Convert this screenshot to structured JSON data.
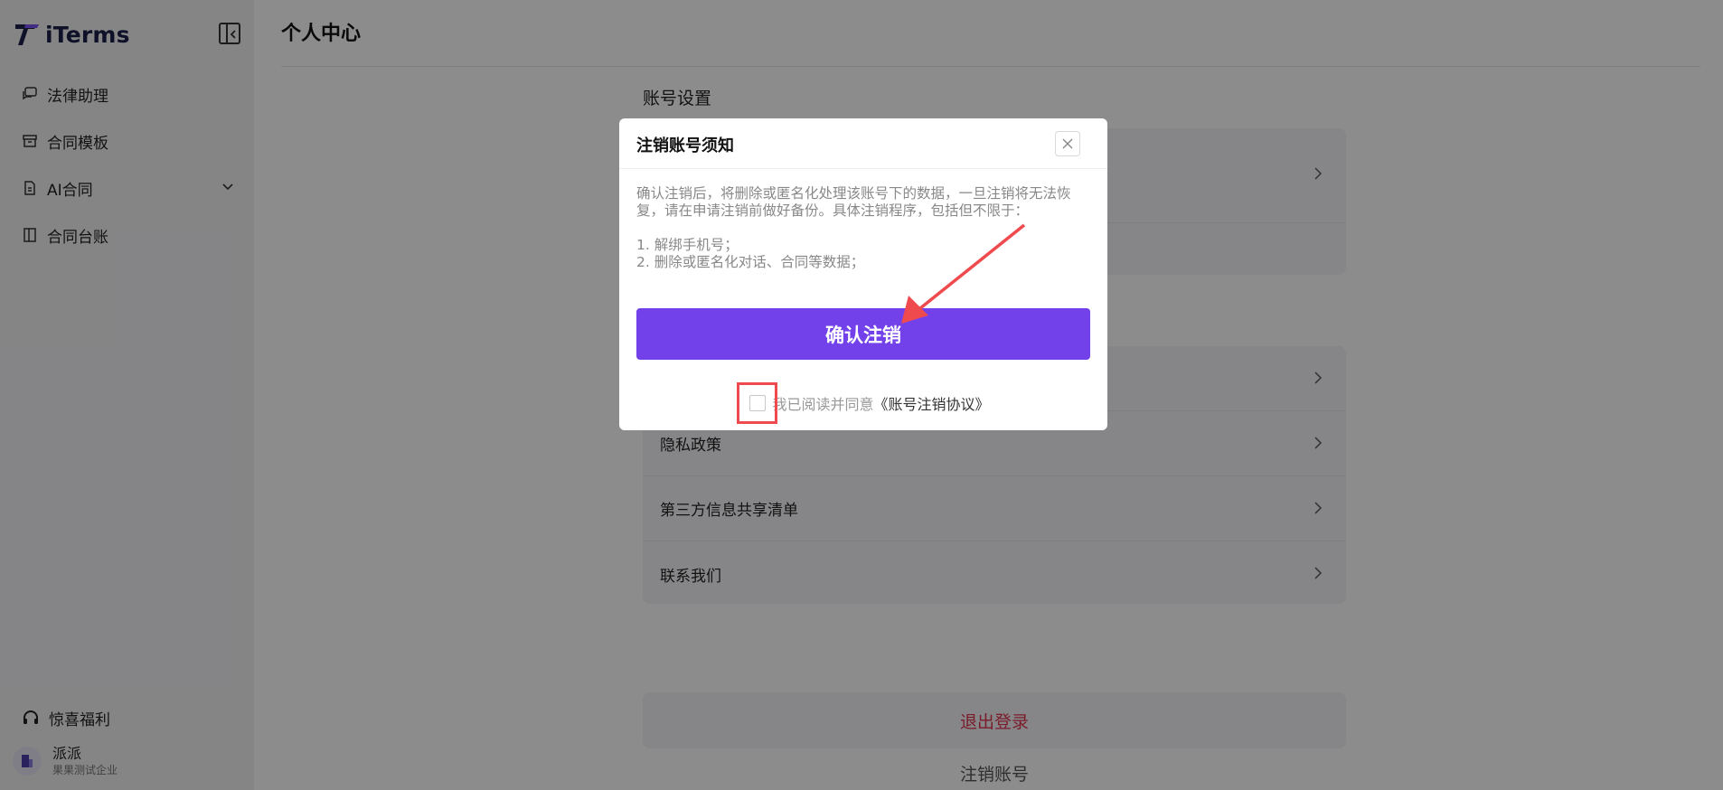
{
  "sidebar": {
    "brand": "iTerms",
    "nav": [
      {
        "label": "法律助理",
        "icon": "chat-icon"
      },
      {
        "label": "合同模板",
        "icon": "archive-icon"
      },
      {
        "label": "AI合同",
        "icon": "document-icon",
        "expandable": true
      },
      {
        "label": "合同台账",
        "icon": "ledger-icon"
      }
    ],
    "gift_label": "惊喜福利",
    "user": {
      "name": "派派",
      "org": "果果测试企业"
    }
  },
  "main": {
    "title": "个人中心",
    "section_title": "账号设置",
    "card2_rows": [
      "隐私政策",
      "第三方信息共享清单",
      "联系我们"
    ],
    "logout_label": "退出登录",
    "cancel_label": "注销账号"
  },
  "modal": {
    "title": "注销账号须知",
    "body": "确认注销后，将删除或匿名化处理该账号下的数据，一旦注销将无法恢复，请在申请注销前做好备份。具体注销程序，包括但不限于：",
    "list": [
      "1. 解绑手机号；",
      "2. 删除或匿名化对话、合同等数据；"
    ],
    "confirm_label": "确认注销",
    "agree_text": "我已阅读并同意",
    "agree_link": "《账号注销协议》"
  },
  "colors": {
    "accent": "#7241ea",
    "danger": "#e0334f",
    "annotation": "#ef4b4f"
  }
}
